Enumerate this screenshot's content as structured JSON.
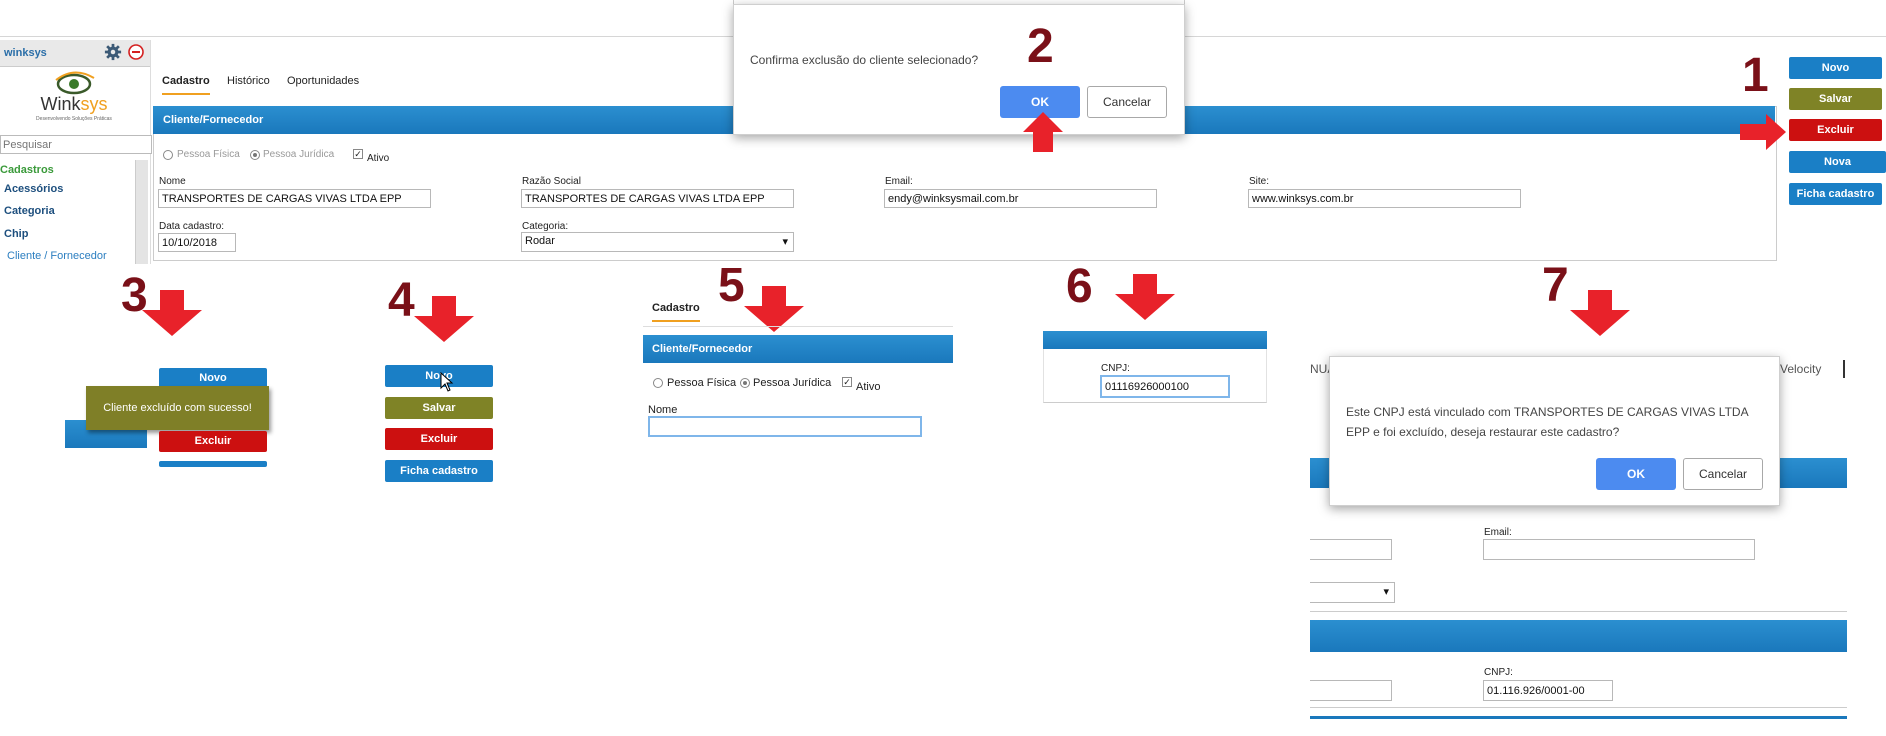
{
  "app": {
    "user": "winksys",
    "logo_text": "Winksys",
    "logo_tagline": "Desenvolvendo Soluções Práticas"
  },
  "sidebar": {
    "search_placeholder": "Pesquisar",
    "section": "Cadastros",
    "items": [
      "Acessórios",
      "Categoria",
      "Chip",
      "Cliente / Fornecedor"
    ]
  },
  "tabs": [
    "Cadastro",
    "Histórico",
    "Oportunidades"
  ],
  "form": {
    "section_title": "Cliente/Fornecedor",
    "radio_fisica": "Pessoa Física",
    "radio_juridica": "Pessoa Jurídica",
    "check_ativo": "Ativo",
    "nome_label": "Nome",
    "nome_value": "TRANSPORTES DE CARGAS VIVAS LTDA EPP",
    "razao_label": "Razão Social",
    "razao_value": "TRANSPORTES DE CARGAS VIVAS LTDA EPP",
    "email_label": "Email:",
    "email_value": "endy@winksysmail.com.br",
    "site_label": "Site:",
    "site_value": "www.winksys.com.br",
    "data_label": "Data cadastro:",
    "data_value": "10/10/2018",
    "categoria_label": "Categoria:",
    "categoria_value": "Rodar"
  },
  "actions": {
    "novo": "Novo",
    "salvar": "Salvar",
    "excluir": "Excluir",
    "nova_oportunidade": "Nova Oportunidade",
    "ficha": "Ficha cadastro"
  },
  "confirm_dialog": {
    "message": "Confirma exclusão do cliente selecionado?",
    "ok": "OK",
    "cancel": "Cancelar"
  },
  "steps": [
    "1",
    "2",
    "3",
    "4",
    "5",
    "6",
    "7"
  ],
  "step3": {
    "toast": "Cliente excluído com sucesso!",
    "novo": "Novo",
    "excluir": "Excluir"
  },
  "step4": {
    "novo": "Novo",
    "salvar": "Salvar",
    "excluir": "Excluir",
    "ficha": "Ficha cadastro"
  },
  "step5": {
    "tab": "Cadastro",
    "section_title": "Cliente/Fornecedor",
    "radio_fisica": "Pessoa Física",
    "radio_juridica": "Pessoa Jurídica",
    "check_ativo": "Ativo",
    "nome_label": "Nome"
  },
  "step6": {
    "cnpj_label": "CNPJ:",
    "cnpj_value": "01116926000100"
  },
  "step7": {
    "tab_left": "NUA",
    "tab_right": "Velocity",
    "message": "Este CNPJ está vinculado com TRANSPORTES DE CARGAS VIVAS LTDA EPP e foi excluído, deseja restaurar este cadastro?",
    "ok": "OK",
    "cancel": "Cancelar",
    "email_label": "Email:",
    "cnpj_label": "CNPJ:",
    "cnpj_value": "01.116.926/0001-00"
  },
  "colors": {
    "accent_blue": "#1a7fc6",
    "olive": "#7f8326",
    "red": "#cc1010",
    "step_number": "#7a1018",
    "arrow": "#e8222a"
  }
}
